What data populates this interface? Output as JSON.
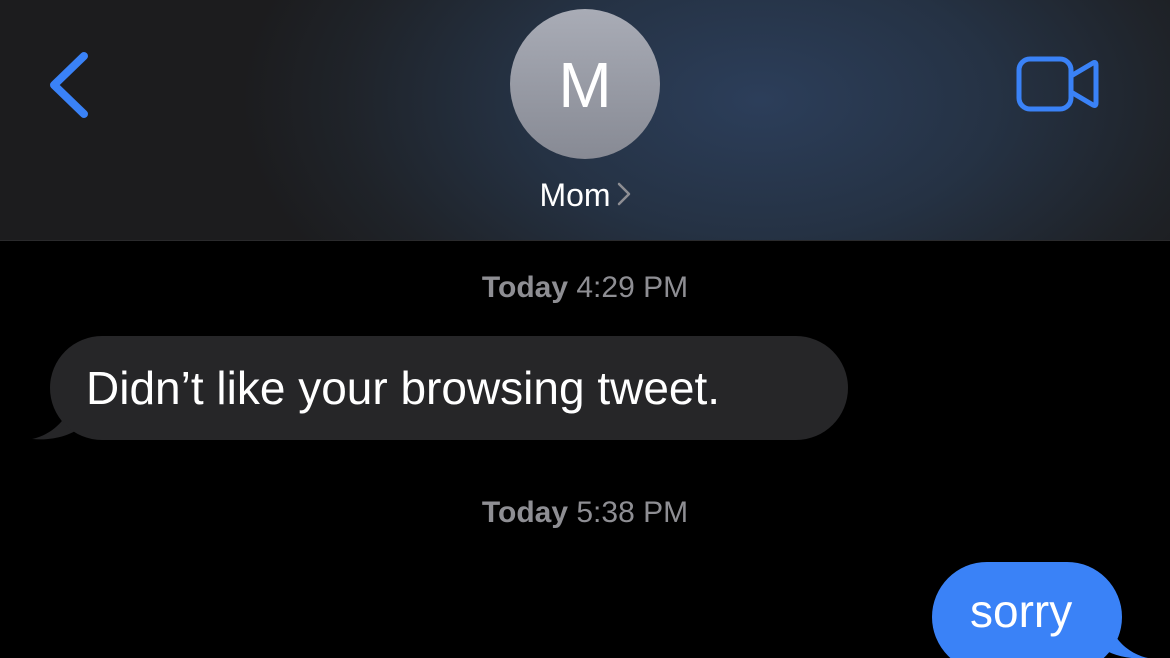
{
  "colors": {
    "accent": "#3a82f7",
    "incoming_bubble": "#262628",
    "outgoing_bubble": "#3a82f7",
    "timestamp": "#8e8e93"
  },
  "header": {
    "back_icon": "chevron-left-icon",
    "avatar_initial": "M",
    "contact_name": "Mom",
    "contact_chevron_icon": "chevron-right-icon",
    "video_icon": "video-camera-icon"
  },
  "messages": [
    {
      "timestamp_day": "Today",
      "timestamp_time": "4:29 PM",
      "direction": "incoming",
      "text": "Didn’t like your browsing tweet."
    },
    {
      "timestamp_day": "Today",
      "timestamp_time": "5:38 PM",
      "direction": "outgoing",
      "text": "sorry"
    }
  ]
}
